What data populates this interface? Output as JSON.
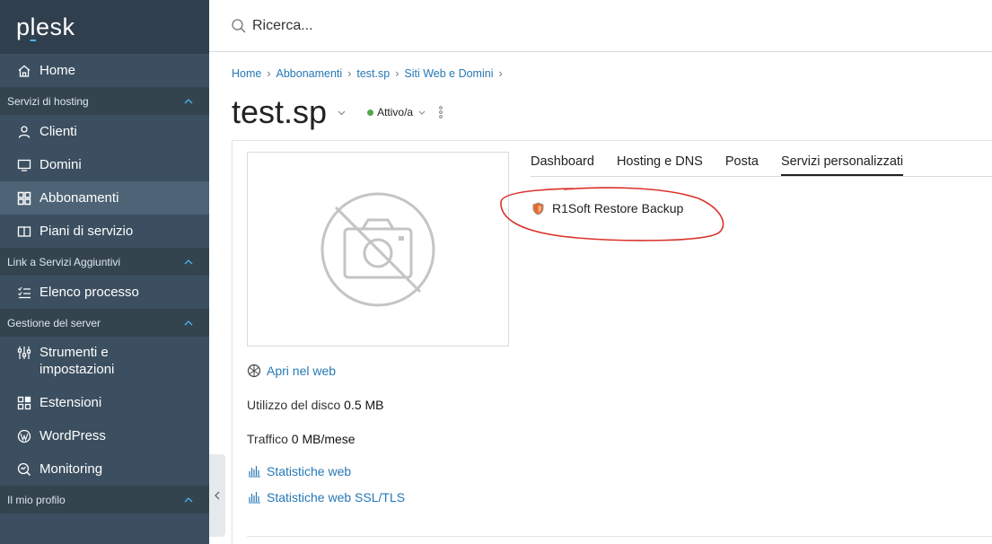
{
  "brand": {
    "logo_prefix": "p",
    "logo_under": "l",
    "logo_suffix": "esk"
  },
  "search": {
    "placeholder": "Ricerca..."
  },
  "sidebar": {
    "home": "Home",
    "section_hosting": "Servizi di hosting",
    "clients": "Clienti",
    "domains": "Domini",
    "subscriptions": "Abbonamenti",
    "service_plans": "Piani di servizio",
    "section_links": "Link a Servizi Aggiuntivi",
    "process_list": "Elenco processo",
    "section_server": "Gestione del server",
    "tools_line1": "Strumenti e",
    "tools_line2": "impostazioni",
    "extensions": "Estensioni",
    "wordpress": "WordPress",
    "monitoring": "Monitoring",
    "section_profile": "Il mio profilo"
  },
  "breadcrumb": [
    "Home",
    "Abbonamenti",
    "test.sp",
    "Siti Web e Domini"
  ],
  "page": {
    "title": "test.sp",
    "status": "Attivo/a",
    "status_color": "#51a94a"
  },
  "tabs": [
    "Dashboard",
    "Hosting e DNS",
    "Posta",
    "Servizi personalizzati"
  ],
  "active_tab": "Servizi personalizzati",
  "service": {
    "label": "R1Soft Restore Backup"
  },
  "info": {
    "open_web": "Apri nel web",
    "disk_label": "Utilizzo del disco",
    "disk_value": "0.5 MB",
    "traffic_label": "Traffico",
    "traffic_value": "0 MB/mese",
    "web_stats": "Statistiche web",
    "web_stats_ssl": "Statistiche web SSL/TLS"
  },
  "colors": {
    "sidebar": "#3c4f60",
    "link": "#2778b5",
    "accent": "#4bb3f0",
    "annotation": "#d9332b"
  }
}
